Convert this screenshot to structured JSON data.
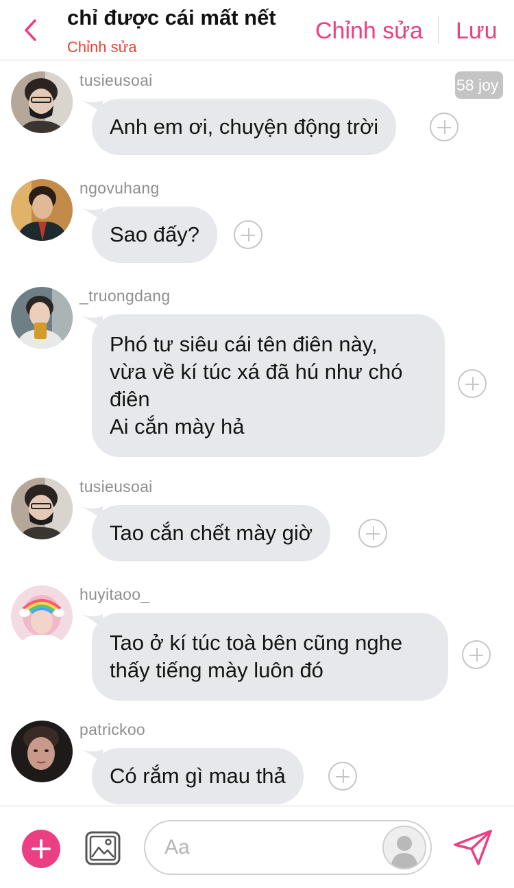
{
  "header": {
    "title": "chỉ được cái mất nết",
    "subtitle": "Chỉnh sửa",
    "edit_label": "Chỉnh sửa",
    "save_label": "Lưu",
    "accent_color": "#ec3e82",
    "subtitle_color": "#e8432f",
    "back_icon": "chevron-left-icon"
  },
  "joy_badge": "58 joy",
  "messages": [
    {
      "username": "tusieusoai",
      "lines": [
        "Anh em ơi, chuyện động trời"
      ]
    },
    {
      "username": "ngovuhang",
      "lines": [
        "Sao đấy?"
      ]
    },
    {
      "username": "_truongdang",
      "lines": [
        "Phó tư siêu cái tên điên này,",
        "vừa về kí túc xá đã hú như chó",
        "điên",
        "Ai cắn mày hả"
      ]
    },
    {
      "username": "tusieusoai",
      "lines": [
        "Tao cắn chết mày giờ"
      ]
    },
    {
      "username": "huyitaoo_",
      "lines": [
        "Tao ở kí túc toà bên cũng nghe",
        "thấy tiếng mày luôn đó"
      ]
    },
    {
      "username": "patrickoo",
      "lines": [
        "Có rắm gì mau thả"
      ]
    }
  ],
  "composer": {
    "placeholder": "Aa",
    "add_icon": "plus-circle-icon",
    "image_icon": "image-icon",
    "send_icon": "paper-plane-icon"
  }
}
